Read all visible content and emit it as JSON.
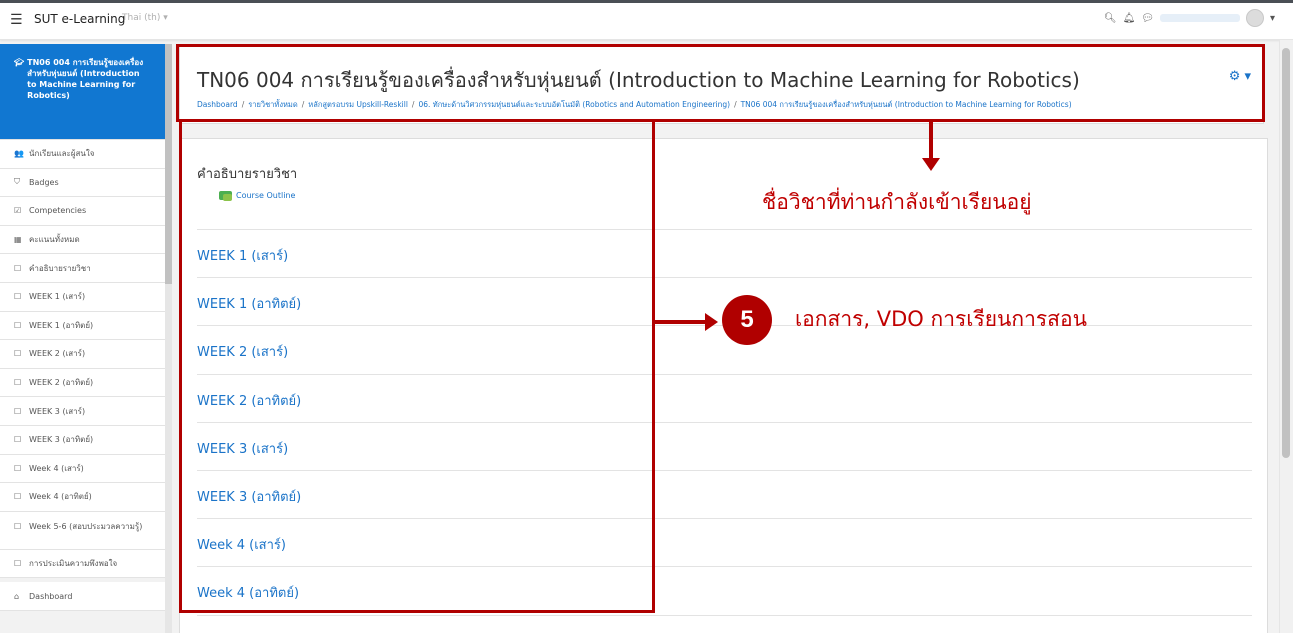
{
  "navbar": {
    "site_name": "SUT e-Learning",
    "language": "Thai (th) ▾",
    "hamburger_icon": "menu-icon",
    "search_icon": "search-icon",
    "bell_icon": "bell-icon",
    "chat_icon": "chat-icon",
    "caret": "▾"
  },
  "sidebar": {
    "course_item": "TN06 004 การเรียนรู้ของเครื่องสำหรับหุ่นยนต์ (Introduction to Machine Learning for Robotics)",
    "items": [
      {
        "icon": "👥",
        "label": "นักเรียนและผู้สนใจ"
      },
      {
        "icon": "⛉",
        "label": "Badges"
      },
      {
        "icon": "☑",
        "label": "Competencies"
      },
      {
        "icon": "▦",
        "label": "คะแนนทั้งหมด"
      },
      {
        "icon": "☐",
        "label": "คำอธิบายรายวิชา"
      },
      {
        "icon": "☐",
        "label": "WEEK 1 (เสาร์)"
      },
      {
        "icon": "☐",
        "label": "WEEK 1 (อาทิตย์)"
      },
      {
        "icon": "☐",
        "label": "WEEK 2 (เสาร์)"
      },
      {
        "icon": "☐",
        "label": "WEEK 2 (อาทิตย์)"
      },
      {
        "icon": "☐",
        "label": "WEEK 3 (เสาร์)"
      },
      {
        "icon": "☐",
        "label": "WEEK 3 (อาทิตย์)"
      },
      {
        "icon": "☐",
        "label": "Week 4 (เสาร์)"
      },
      {
        "icon": "☐",
        "label": "Week 4 (อาทิตย์)"
      },
      {
        "icon": "☐",
        "label": "Week 5-6 (สอบประมวลความรู้)"
      },
      {
        "icon": "☐",
        "label": "การประเมินความพึงพอใจ"
      }
    ],
    "dashboard": {
      "icon": "⌂",
      "label": "Dashboard"
    }
  },
  "header": {
    "title": "TN06 004 การเรียนรู้ของเครื่องสำหรับหุ่นยนต์ (Introduction to Machine Learning for Robotics)",
    "gear": "⚙ ▾",
    "breadcrumb": [
      "Dashboard",
      "รายวิชาทั้งหมด",
      "หลักสูตรอบรม Upskill-Reskill",
      "06. ทักษะด้านวิศวกรรมหุ่นยนต์และระบบอัตโนมัติ (Robotics and Automation Engineering)",
      "TN06 004 การเรียนรู้ของเครื่องสำหรับหุ่นยนต์ (Introduction to Machine Learning for Robotics)"
    ],
    "breadcrumb_sep": "/"
  },
  "content": {
    "outline_title": "คำอธิบายรายวิชา",
    "outline_link": "Course Outline",
    "sections": [
      "WEEK 1 (เสาร์)",
      "WEEK 1 (อาทิตย์)",
      "WEEK 2 (เสาร์)",
      "WEEK 2 (อาทิตย์)",
      "WEEK 3 (เสาร์)",
      "WEEK 3 (อาทิตย์)",
      "Week 4 (เสาร์)",
      "Week 4 (อาทิตย์)",
      "Week 5-6 (สอบประมวลความรู้)"
    ]
  },
  "annotations": {
    "course_name_note": "ชื่อวิชาที่ท่านกำลังเข้าเรียนอยู่",
    "step_number": "5",
    "materials_note": "เอกสาร, VDO การเรียนการสอน",
    "color": "#b00000"
  }
}
